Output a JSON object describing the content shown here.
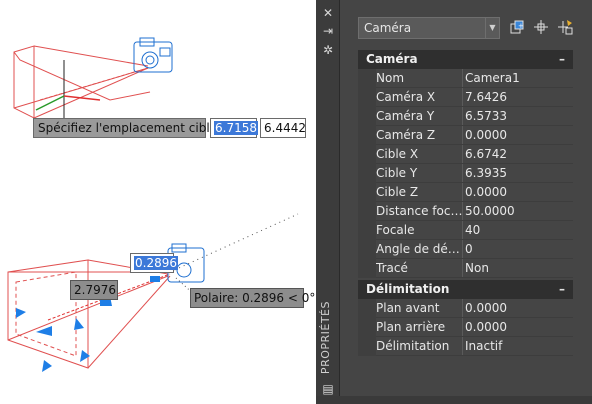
{
  "viewport": {
    "prompt_text": "Spécifiez l'emplacement cible:",
    "coord_x": "6.7158",
    "coord_y": "6.4442",
    "dim_value": "0.2896",
    "length_value": "2.7976",
    "polar_text": "Polaire: 0.2896 < 0°"
  },
  "strip": {
    "close_icon": "✕",
    "pin_icon": "⇥",
    "settings_icon": "✲",
    "label": "PROPRIÉTÉS",
    "menu_icon": "▤"
  },
  "panel": {
    "selector_value": "Caméra",
    "sections": [
      {
        "title": "Caméra",
        "collapse": "–",
        "rows": [
          {
            "label": "Nom",
            "value": "Camera1"
          },
          {
            "label": "Caméra X",
            "value": "7.6426"
          },
          {
            "label": "Caméra Y",
            "value": "6.5733"
          },
          {
            "label": "Caméra Z",
            "value": "0.0000"
          },
          {
            "label": "Cible X",
            "value": "6.6742"
          },
          {
            "label": "Cible Y",
            "value": "6.3935"
          },
          {
            "label": "Cible Z",
            "value": "0.0000"
          },
          {
            "label": "Distance foc…",
            "value": "50.0000"
          },
          {
            "label": "Focale",
            "value": "40"
          },
          {
            "label": "Angle de dé…",
            "value": "0"
          },
          {
            "label": "Tracé",
            "value": "Non"
          }
        ]
      },
      {
        "title": "Délimitation",
        "collapse": "–",
        "rows": [
          {
            "label": "Plan avant",
            "value": "0.0000"
          },
          {
            "label": "Plan arrière",
            "value": "0.0000"
          },
          {
            "label": "Délimitation",
            "value": "Inactif"
          }
        ]
      }
    ]
  },
  "colors": {
    "frustum": "#e03030",
    "camera": "#1e6fd0",
    "grip": "#1e7ee6",
    "axis_green": "#2a9a2a"
  }
}
